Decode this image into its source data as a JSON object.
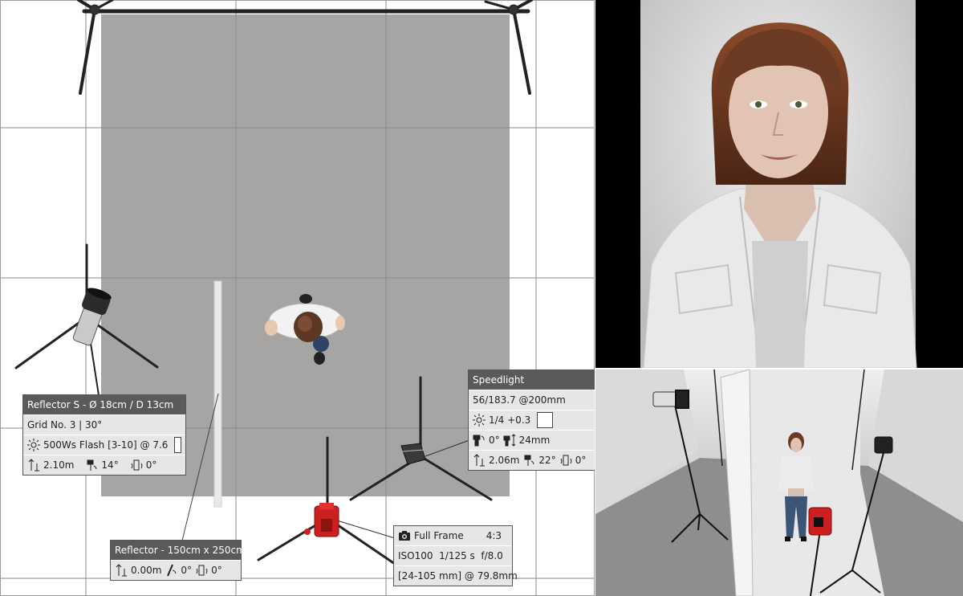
{
  "reflector_s": {
    "title": "Reflector S - Ø 18cm / D 13cm",
    "grid": "Grid No. 3 | 30°",
    "flash": "500Ws Flash [3-10] @ 7.6",
    "height": "2.10m",
    "tilt": "14°",
    "rotation": "0°",
    "swatch_color": "#ffffff"
  },
  "speedlight": {
    "title": "Speedlight",
    "zoom": "56/183.7 @200mm",
    "power": "1/4 +0.3",
    "tilt_angle": "0°",
    "zoom_mm": "24mm",
    "height": "2.06m",
    "tilt": "22°",
    "rotation": "0°",
    "swatch_color": "#ffffff"
  },
  "reflector_panel": {
    "title": "Reflector - 150cm x 250cm",
    "height": "0.00m",
    "tilt": "0°",
    "rotation": "0°"
  },
  "camera": {
    "sensor": "Full Frame",
    "ratio": "4:3",
    "exposure": "ISO100  1/125 s  f/8.0",
    "lens": "[24-105 mm] @ 79.8mm"
  },
  "colors": {
    "backdrop": "#a7a5a4",
    "camera_body": "#cc1f1f",
    "panel_header": "#5a5a5a",
    "panel_body": "#e6e6e6"
  }
}
